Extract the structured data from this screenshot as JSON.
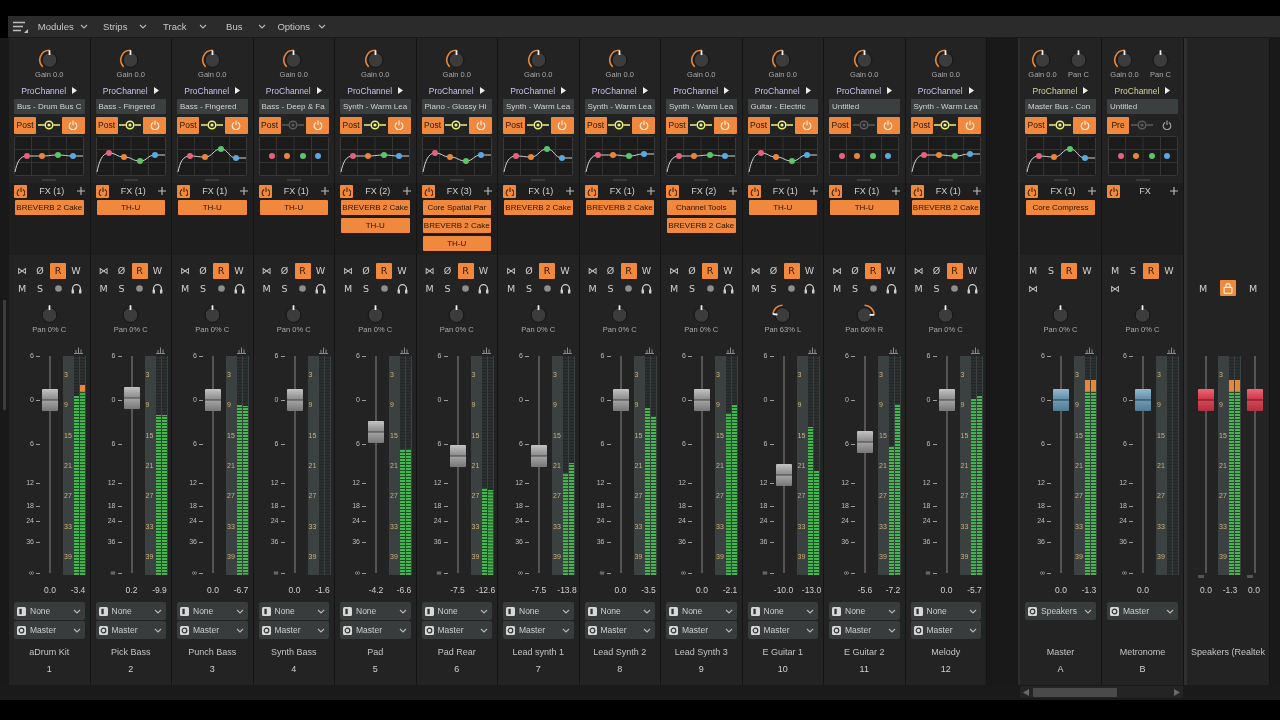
{
  "menu": [
    {
      "label": "Modules"
    },
    {
      "label": "Strips"
    },
    {
      "label": "Track"
    },
    {
      "label": "Bus"
    },
    {
      "label": "Options"
    }
  ],
  "tracks": [
    {
      "knobs": [
        {
          "kind": "gain",
          "label": "Gain 0.0",
          "level": 0.5
        }
      ],
      "prochannel": {
        "label": "ProChannel",
        "preset": "Bus - Drum Bus C",
        "mode": "Post",
        "active": true,
        "power": true
      },
      "fx": {
        "label": "FX (1)",
        "power": true,
        "plugins": [
          "BREVERB 2 Cake"
        ]
      },
      "button_rows": [
        [
          {
            "label": "⋈",
            "on": false
          },
          {
            "label": "Ø",
            "on": false
          },
          {
            "label": "R",
            "on": true
          },
          {
            "label": "W",
            "on": false
          }
        ],
        [
          {
            "kind": "toggle",
            "label": "M",
            "on": false
          },
          {
            "kind": "toggle",
            "label": "S",
            "on": false
          },
          {
            "kind": "arm",
            "on": false
          },
          {
            "kind": "monitor",
            "on": false
          }
        ]
      ],
      "pan": {
        "label": "Pan 0% C",
        "level": 0.5
      },
      "scale": [
        "6",
        "0",
        "6",
        "12",
        "18",
        "24",
        "36",
        "∞"
      ],
      "meter_scale": [
        "3",
        "9",
        "15",
        "21",
        "27",
        "33",
        "39"
      ],
      "faders": [
        {
          "level": 0.797
        }
      ],
      "meters": [
        {
          "level": 0.817
        },
        {
          "level": 0.868
        }
      ],
      "readings": [
        "0.0",
        "-3.4"
      ],
      "routing": [
        {
          "kind": "input",
          "value": "None"
        },
        {
          "kind": "output",
          "value": "Master"
        }
      ],
      "name": "aDrum Kit",
      "number": "1"
    },
    {
      "knobs": [
        {
          "kind": "gain",
          "label": "Gain 0.0",
          "level": 0.5
        }
      ],
      "prochannel": {
        "label": "ProChannel",
        "preset": "Bass - Fingered",
        "mode": "Post",
        "active": true,
        "power": true
      },
      "fx": {
        "label": "FX (1)",
        "power": true,
        "plugins": [
          "TH-U"
        ]
      },
      "button_rows": [
        [
          {
            "label": "⋈",
            "on": false
          },
          {
            "label": "Ø",
            "on": false
          },
          {
            "label": "R",
            "on": true
          },
          {
            "label": "W",
            "on": false
          }
        ],
        [
          {
            "kind": "toggle",
            "label": "M",
            "on": false
          },
          {
            "kind": "toggle",
            "label": "S",
            "on": false
          },
          {
            "kind": "arm",
            "on": false
          },
          {
            "kind": "monitor",
            "on": false
          }
        ]
      ],
      "pan": {
        "label": "Pan 0% C",
        "level": 0.5
      },
      "scale": [
        "6",
        "0",
        "6",
        "12",
        "18",
        "24",
        "36",
        "∞"
      ],
      "meter_scale": [
        "3",
        "9",
        "15",
        "21",
        "27",
        "33",
        "39"
      ],
      "faders": [
        {
          "level": 0.806
        }
      ],
      "meters": [
        {
          "level": 0.73
        },
        {
          "level": 0.73
        }
      ],
      "readings": [
        "0.2",
        "-9.9"
      ],
      "routing": [
        {
          "kind": "input",
          "value": "None"
        },
        {
          "kind": "output",
          "value": "Master"
        }
      ],
      "name": "Pick Bass",
      "number": "2"
    },
    {
      "knobs": [
        {
          "kind": "gain",
          "label": "Gain 0.0",
          "level": 0.5
        }
      ],
      "prochannel": {
        "label": "ProChannel",
        "preset": "Bass - Fingered",
        "mode": "Post",
        "active": true,
        "power": true
      },
      "fx": {
        "label": "FX (1)",
        "power": true,
        "plugins": [
          "TH-U"
        ]
      },
      "button_rows": [
        [
          {
            "label": "⋈",
            "on": false
          },
          {
            "label": "Ø",
            "on": false
          },
          {
            "label": "R",
            "on": true
          },
          {
            "label": "W",
            "on": false
          }
        ],
        [
          {
            "kind": "toggle",
            "label": "M",
            "on": false
          },
          {
            "kind": "toggle",
            "label": "S",
            "on": false
          },
          {
            "kind": "arm",
            "on": false
          },
          {
            "kind": "monitor",
            "on": false
          }
        ]
      ],
      "pan": {
        "label": "Pan 0% C",
        "level": 0.5
      },
      "scale": [
        "6",
        "0",
        "6",
        "12",
        "18",
        "24",
        "36",
        "∞"
      ],
      "meter_scale": [
        "3",
        "9",
        "15",
        "21",
        "27",
        "33",
        "39"
      ],
      "faders": [
        {
          "level": 0.797
        }
      ],
      "meters": [
        {
          "level": 0.776
        },
        {
          "level": 0.77
        }
      ],
      "readings": [
        "0.0",
        "-6.7"
      ],
      "routing": [
        {
          "kind": "input",
          "value": "None"
        },
        {
          "kind": "output",
          "value": "Master"
        }
      ],
      "name": "Punch Bass",
      "number": "3"
    },
    {
      "knobs": [
        {
          "kind": "gain",
          "label": "Gain 0.0",
          "level": 0.5
        }
      ],
      "prochannel": {
        "label": "ProChannel",
        "preset": "Bass - Deep & Fa",
        "mode": "Post",
        "active": false,
        "power": true
      },
      "fx": {
        "label": "FX (1)",
        "power": true,
        "plugins": [
          "TH-U"
        ]
      },
      "button_rows": [
        [
          {
            "label": "⋈",
            "on": false
          },
          {
            "label": "Ø",
            "on": false
          },
          {
            "label": "R",
            "on": true
          },
          {
            "label": "W",
            "on": false
          }
        ],
        [
          {
            "kind": "toggle",
            "label": "M",
            "on": false
          },
          {
            "kind": "toggle",
            "label": "S",
            "on": false
          },
          {
            "kind": "arm",
            "on": false
          },
          {
            "kind": "monitor",
            "on": false
          }
        ]
      ],
      "pan": {
        "label": "Pan 0% C",
        "level": 0.5
      },
      "scale": [
        "6",
        "0",
        "6",
        "12",
        "18",
        "24",
        "36",
        "∞"
      ],
      "meter_scale": [
        "3",
        "9",
        "15",
        "21",
        "27",
        "33",
        "39"
      ],
      "faders": [
        {
          "level": 0.797
        }
      ],
      "readings": [
        "0.0",
        "-1.6"
      ],
      "routing": [
        {
          "kind": "input",
          "value": "None"
        },
        {
          "kind": "output",
          "value": "Master"
        }
      ],
      "name": "Synth Bass",
      "number": "4"
    },
    {
      "knobs": [
        {
          "kind": "gain",
          "label": "Gain 0.0",
          "level": 0.5
        }
      ],
      "prochannel": {
        "label": "ProChannel",
        "preset": "Synth - Warm Lea",
        "mode": "Post",
        "active": true,
        "power": true
      },
      "fx": {
        "label": "FX (2)",
        "power": true,
        "plugins": [
          "BREVERB 2 Cake",
          "TH-U"
        ]
      },
      "button_rows": [
        [
          {
            "label": "⋈",
            "on": false
          },
          {
            "label": "Ø",
            "on": false
          },
          {
            "label": "R",
            "on": true
          },
          {
            "label": "W",
            "on": false
          }
        ],
        [
          {
            "kind": "toggle",
            "label": "M",
            "on": false
          },
          {
            "kind": "toggle",
            "label": "S",
            "on": false
          },
          {
            "kind": "arm",
            "on": false
          },
          {
            "kind": "monitor",
            "on": false
          }
        ]
      ],
      "pan": {
        "label": "Pan 0% C",
        "level": 0.5
      },
      "scale": [
        "6",
        "0",
        "6",
        "12",
        "18",
        "24",
        "36",
        "∞"
      ],
      "meter_scale": [
        "3",
        "9",
        "15",
        "21",
        "27",
        "33",
        "39"
      ],
      "faders": [
        {
          "level": 0.65
        }
      ],
      "meters": [
        {
          "level": 0.575
        },
        {
          "level": 0.575
        }
      ],
      "readings": [
        "-4.2",
        "-6.6"
      ],
      "routing": [
        {
          "kind": "input",
          "value": "None"
        },
        {
          "kind": "output",
          "value": "Master"
        }
      ],
      "name": "Pad",
      "number": "5"
    },
    {
      "knobs": [
        {
          "kind": "gain",
          "label": "Gain 0.0",
          "level": 0.5
        }
      ],
      "prochannel": {
        "label": "ProChannel",
        "preset": "Piano - Glossy Hi",
        "mode": "Post",
        "active": true,
        "power": true
      },
      "fx": {
        "label": "FX (3)",
        "power": true,
        "plugins": [
          "Core Spatial Par",
          "BREVERB 2 Cake",
          "TH-U"
        ]
      },
      "button_rows": [
        [
          {
            "label": "⋈",
            "on": false
          },
          {
            "label": "Ø",
            "on": false
          },
          {
            "label": "R",
            "on": true
          },
          {
            "label": "W",
            "on": false
          }
        ],
        [
          {
            "kind": "toggle",
            "label": "M",
            "on": false
          },
          {
            "kind": "toggle",
            "label": "S",
            "on": false
          },
          {
            "kind": "arm",
            "on": false
          },
          {
            "kind": "monitor",
            "on": false
          }
        ]
      ],
      "pan": {
        "label": "Pan 0% C",
        "level": 0.5
      },
      "scale": [
        "6",
        "0",
        "6",
        "12",
        "18",
        "24",
        "36",
        "∞"
      ],
      "meter_scale": [
        "3",
        "9",
        "15",
        "21",
        "27",
        "33",
        "39"
      ],
      "faders": [
        {
          "level": 0.539
        }
      ],
      "meters": [
        {
          "level": 0.397
        },
        {
          "level": 0.39
        }
      ],
      "readings": [
        "-7.5",
        "-12.6"
      ],
      "routing": [
        {
          "kind": "input",
          "value": "None"
        },
        {
          "kind": "output",
          "value": "Master"
        }
      ],
      "name": "Pad Rear",
      "number": "6"
    },
    {
      "knobs": [
        {
          "kind": "gain",
          "label": "Gain 0.0",
          "level": 0.5
        }
      ],
      "prochannel": {
        "label": "ProChannel",
        "preset": "Synth - Warm Lea",
        "mode": "Post",
        "active": true,
        "power": true
      },
      "fx": {
        "label": "FX (1)",
        "power": true,
        "plugins": [
          "BREVERB 2 Cake"
        ]
      },
      "button_rows": [
        [
          {
            "label": "⋈",
            "on": false
          },
          {
            "label": "Ø",
            "on": false
          },
          {
            "label": "R",
            "on": true
          },
          {
            "label": "W",
            "on": false
          }
        ],
        [
          {
            "kind": "toggle",
            "label": "M",
            "on": false
          },
          {
            "kind": "toggle",
            "label": "S",
            "on": false
          },
          {
            "kind": "arm",
            "on": false
          },
          {
            "kind": "monitor",
            "on": false
          }
        ]
      ],
      "pan": {
        "label": "Pan 0% C",
        "level": 0.5
      },
      "scale": [
        "6",
        "0",
        "6",
        "12",
        "18",
        "24",
        "36",
        "∞"
      ],
      "meter_scale": [
        "3",
        "9",
        "15",
        "21",
        "27",
        "33",
        "39"
      ],
      "faders": [
        {
          "level": 0.539
        }
      ],
      "meters": [
        {
          "level": 0.466
        },
        {
          "level": 0.511
        }
      ],
      "readings": [
        "-7.5",
        "-13.8"
      ],
      "routing": [
        {
          "kind": "input",
          "value": "None"
        },
        {
          "kind": "output",
          "value": "Master"
        }
      ],
      "name": "Lead synth 1",
      "number": "7"
    },
    {
      "knobs": [
        {
          "kind": "gain",
          "label": "Gain 0.0",
          "level": 0.5
        }
      ],
      "prochannel": {
        "label": "ProChannel",
        "preset": "Synth - Warm Lea",
        "mode": "Post",
        "active": true,
        "power": true
      },
      "fx": {
        "label": "FX (1)",
        "power": true,
        "plugins": [
          "BREVERB 2 Cake"
        ]
      },
      "button_rows": [
        [
          {
            "label": "⋈",
            "on": false
          },
          {
            "label": "Ø",
            "on": false
          },
          {
            "label": "R",
            "on": true
          },
          {
            "label": "W",
            "on": false
          }
        ],
        [
          {
            "kind": "toggle",
            "label": "M",
            "on": false
          },
          {
            "kind": "toggle",
            "label": "S",
            "on": false
          },
          {
            "kind": "arm",
            "on": false
          },
          {
            "kind": "monitor",
            "on": false
          }
        ]
      ],
      "pan": {
        "label": "Pan 0% C",
        "level": 0.5
      },
      "scale": [
        "6",
        "0",
        "6",
        "12",
        "18",
        "24",
        "36",
        "∞"
      ],
      "meter_scale": [
        "3",
        "9",
        "15",
        "21",
        "27",
        "33",
        "39"
      ],
      "faders": [
        {
          "level": 0.797
        }
      ],
      "meters": [
        {
          "level": 0.762
        },
        {
          "level": 0.726
        }
      ],
      "readings": [
        "0.0",
        "-3.5"
      ],
      "routing": [
        {
          "kind": "input",
          "value": "None"
        },
        {
          "kind": "output",
          "value": "Master"
        }
      ],
      "name": "Lead Synth 2",
      "number": "8"
    },
    {
      "knobs": [
        {
          "kind": "gain",
          "label": "Gain 0.0",
          "level": 0.5
        }
      ],
      "prochannel": {
        "label": "ProChannel",
        "preset": "Synth - Warm Lea",
        "mode": "Post",
        "active": true,
        "power": true
      },
      "fx": {
        "label": "FX (2)",
        "power": true,
        "plugins": [
          "Channel Tools",
          "BREVERB 2 Cake"
        ]
      },
      "button_rows": [
        [
          {
            "label": "⋈",
            "on": false
          },
          {
            "label": "Ø",
            "on": false
          },
          {
            "label": "R",
            "on": true
          },
          {
            "label": "W",
            "on": false
          }
        ],
        [
          {
            "kind": "toggle",
            "label": "M",
            "on": false
          },
          {
            "kind": "toggle",
            "label": "S",
            "on": false
          },
          {
            "kind": "arm",
            "on": false
          },
          {
            "kind": "monitor",
            "on": false
          }
        ]
      ],
      "pan": {
        "label": "Pan 0% C",
        "level": 0.5
      },
      "scale": [
        "6",
        "0",
        "6",
        "12",
        "18",
        "24",
        "36",
        "∞"
      ],
      "meter_scale": [
        "3",
        "9",
        "15",
        "21",
        "27",
        "33",
        "39"
      ],
      "faders": [
        {
          "level": 0.797
        }
      ],
      "meters": [
        {
          "level": 0.74
        },
        {
          "level": 0.776
        }
      ],
      "readings": [
        "0.0",
        "-2.1"
      ],
      "routing": [
        {
          "kind": "input",
          "value": "None"
        },
        {
          "kind": "output",
          "value": "Master"
        }
      ],
      "name": "Lead Synth 3",
      "number": "9"
    },
    {
      "knobs": [
        {
          "kind": "gain",
          "label": "Gain 0.0",
          "level": 0.5
        }
      ],
      "prochannel": {
        "label": "ProChannel",
        "preset": "Guitar - Electric",
        "mode": "Post",
        "active": true,
        "power": true
      },
      "fx": {
        "label": "FX (1)",
        "power": true,
        "plugins": [
          "TH-U"
        ]
      },
      "button_rows": [
        [
          {
            "label": "⋈",
            "on": false
          },
          {
            "label": "Ø",
            "on": false
          },
          {
            "label": "R",
            "on": true
          },
          {
            "label": "W",
            "on": false
          }
        ],
        [
          {
            "kind": "toggle",
            "label": "M",
            "on": false
          },
          {
            "kind": "toggle",
            "label": "S",
            "on": false
          },
          {
            "kind": "arm",
            "on": false
          },
          {
            "kind": "monitor",
            "on": false
          }
        ]
      ],
      "pan": {
        "label": "Pan 63% L",
        "level": 0.185
      },
      "scale": [
        "6",
        "0",
        "6",
        "12",
        "18",
        "24",
        "36",
        "∞"
      ],
      "meter_scale": [
        "3",
        "9",
        "15",
        "21",
        "27",
        "33",
        "39"
      ],
      "faders": [
        {
          "level": 0.452
        }
      ],
      "meters": [
        {
          "level": 0.676
        },
        {
          "level": 0.475
        }
      ],
      "readings": [
        "-10.0",
        "-13.0"
      ],
      "routing": [
        {
          "kind": "input",
          "value": "None"
        },
        {
          "kind": "output",
          "value": "Master"
        }
      ],
      "name": "E Guitar 1",
      "number": "10"
    },
    {
      "knobs": [
        {
          "kind": "gain",
          "label": "Gain 0.0",
          "level": 0.5
        }
      ],
      "prochannel": {
        "label": "ProChannel",
        "preset": "Untitled",
        "mode": "Post",
        "active": false,
        "power": true
      },
      "fx": {
        "label": "FX (1)",
        "power": true,
        "plugins": [
          "TH-U"
        ]
      },
      "button_rows": [
        [
          {
            "label": "⋈",
            "on": false
          },
          {
            "label": "Ø",
            "on": false
          },
          {
            "label": "R",
            "on": true
          },
          {
            "label": "W",
            "on": false
          }
        ],
        [
          {
            "kind": "toggle",
            "label": "M",
            "on": false
          },
          {
            "kind": "toggle",
            "label": "S",
            "on": false
          },
          {
            "kind": "arm",
            "on": false
          },
          {
            "kind": "monitor",
            "on": false
          }
        ]
      ],
      "pan": {
        "label": "Pan 66% R",
        "level": 0.83
      },
      "scale": [
        "6",
        "0",
        "6",
        "12",
        "18",
        "24",
        "36",
        "∞"
      ],
      "meter_scale": [
        "3",
        "9",
        "15",
        "21",
        "27",
        "33",
        "39"
      ],
      "faders": [
        {
          "level": 0.604
        }
      ],
      "meters": [
        {
          "level": 0.589
        },
        {
          "level": 0.78
        }
      ],
      "readings": [
        "-5.6",
        "-7.2"
      ],
      "routing": [
        {
          "kind": "input",
          "value": "None"
        },
        {
          "kind": "output",
          "value": "Master"
        }
      ],
      "name": "E Guitar 2",
      "number": "11"
    },
    {
      "knobs": [
        {
          "kind": "gain",
          "label": "Gain 0.0",
          "level": 0.5
        }
      ],
      "prochannel": {
        "label": "ProChannel",
        "preset": "Synth - Warm Lea",
        "mode": "Post",
        "active": true,
        "power": true
      },
      "fx": {
        "label": "FX (1)",
        "power": true,
        "plugins": [
          "BREVERB 2 Cake"
        ]
      },
      "button_rows": [
        [
          {
            "label": "⋈",
            "on": false
          },
          {
            "label": "Ø",
            "on": false
          },
          {
            "label": "R",
            "on": true
          },
          {
            "label": "W",
            "on": false
          }
        ],
        [
          {
            "kind": "toggle",
            "label": "M",
            "on": false
          },
          {
            "kind": "toggle",
            "label": "S",
            "on": false
          },
          {
            "kind": "arm",
            "on": false
          },
          {
            "kind": "monitor",
            "on": false
          }
        ]
      ],
      "pan": {
        "label": "Pan 0% C",
        "level": 0.5
      },
      "scale": [
        "6",
        "0",
        "6",
        "12",
        "18",
        "24",
        "36",
        "∞"
      ],
      "meter_scale": [
        "3",
        "9",
        "15",
        "21",
        "27",
        "33",
        "39"
      ],
      "faders": [
        {
          "level": 0.797
        }
      ],
      "meters": [
        {
          "level": 0.804
        },
        {
          "level": 0.817
        }
      ],
      "readings": [
        "0.0",
        "-5.7"
      ],
      "routing": [
        {
          "kind": "input",
          "value": "None"
        },
        {
          "kind": "output",
          "value": "Master"
        }
      ],
      "name": "Melody",
      "number": "12"
    }
  ],
  "buses": [
    {
      "knobs": [
        {
          "kind": "gain",
          "label": "Gain 0.0",
          "level": 0.5
        },
        {
          "kind": "pan",
          "label": "Pan C",
          "level": 0.5
        }
      ],
      "prochannel": {
        "label": "ProChannel",
        "preset": "Master Bus - Con",
        "mode": "Post",
        "active": true,
        "power": true
      },
      "fx": {
        "label": "FX (1)",
        "power": true,
        "plugins": [
          "Core Compress"
        ]
      },
      "button_rows": [
        [
          {
            "label": "M",
            "on": false
          },
          {
            "label": "S",
            "on": false
          },
          {
            "label": "R",
            "on": true
          },
          {
            "label": "W",
            "on": false
          }
        ],
        [
          {
            "label": "⋈",
            "on": false
          }
        ]
      ],
      "pan": {
        "label": "Pan 0% C",
        "level": 0.5
      },
      "scale": [
        "6",
        "0",
        "6",
        "12",
        "18",
        "24",
        "36",
        "∞"
      ],
      "meter_scale": [
        "3",
        "9",
        "15",
        "21",
        "27",
        "33",
        "39"
      ],
      "faders": [
        {
          "level": 0.797
        }
      ],
      "meters": [
        {
          "level": 0.89
        },
        {
          "level": 0.89
        }
      ],
      "readings": [
        "0.0",
        "-1.3"
      ],
      "routing": [
        {
          "kind": "output",
          "value": "Speakers"
        }
      ],
      "name": "Master",
      "number": "A"
    },
    {
      "knobs": [
        {
          "kind": "gain",
          "label": "Gain 0.0",
          "level": 0.5
        },
        {
          "kind": "pan",
          "label": "Pan C",
          "level": 0.5
        }
      ],
      "prochannel": {
        "label": "ProChannel",
        "preset": "Untitled",
        "mode": "Pre",
        "active": false,
        "power": false
      },
      "fx": {
        "label": "FX",
        "power": true
      },
      "button_rows": [
        [
          {
            "label": "M",
            "on": false
          },
          {
            "label": "S",
            "on": false
          },
          {
            "label": "R",
            "on": true
          },
          {
            "label": "W",
            "on": false
          }
        ],
        [
          {
            "label": "⋈",
            "on": false
          }
        ]
      ],
      "pan": {
        "label": "Pan 0% C",
        "level": 0.5
      },
      "scale": [
        "6",
        "0",
        "6",
        "12",
        "18",
        "24",
        "36",
        "∞"
      ],
      "meter_scale": [
        "3",
        "9",
        "15",
        "21",
        "27",
        "33",
        "39"
      ],
      "faders": [
        {
          "level": 0.797
        }
      ],
      "readings": [
        "0.0"
      ],
      "routing": [
        {
          "kind": "output",
          "value": "Master"
        }
      ],
      "name": "Metronome",
      "number": "B"
    }
  ],
  "outputs": [
    {
      "button_rows": [
        [
          {
            "kind": "toggle",
            "label": "M",
            "on": false
          },
          {
            "kind": "lock",
            "on": true
          },
          {
            "kind": "toggle",
            "label": "M",
            "on": false
          }
        ]
      ],
      "meter_scale": [
        "3",
        "9",
        "15",
        "21",
        "27",
        "33",
        "39"
      ],
      "faders": [
        {
          "level": 0.797
        },
        {
          "level": 0.797
        }
      ],
      "meters": [
        {
          "level": 0.89
        },
        {
          "level": 0.89
        }
      ],
      "readings": [
        "0.0",
        "-1.3",
        "0.0"
      ],
      "name": "Speakers (Realtek"
    }
  ]
}
